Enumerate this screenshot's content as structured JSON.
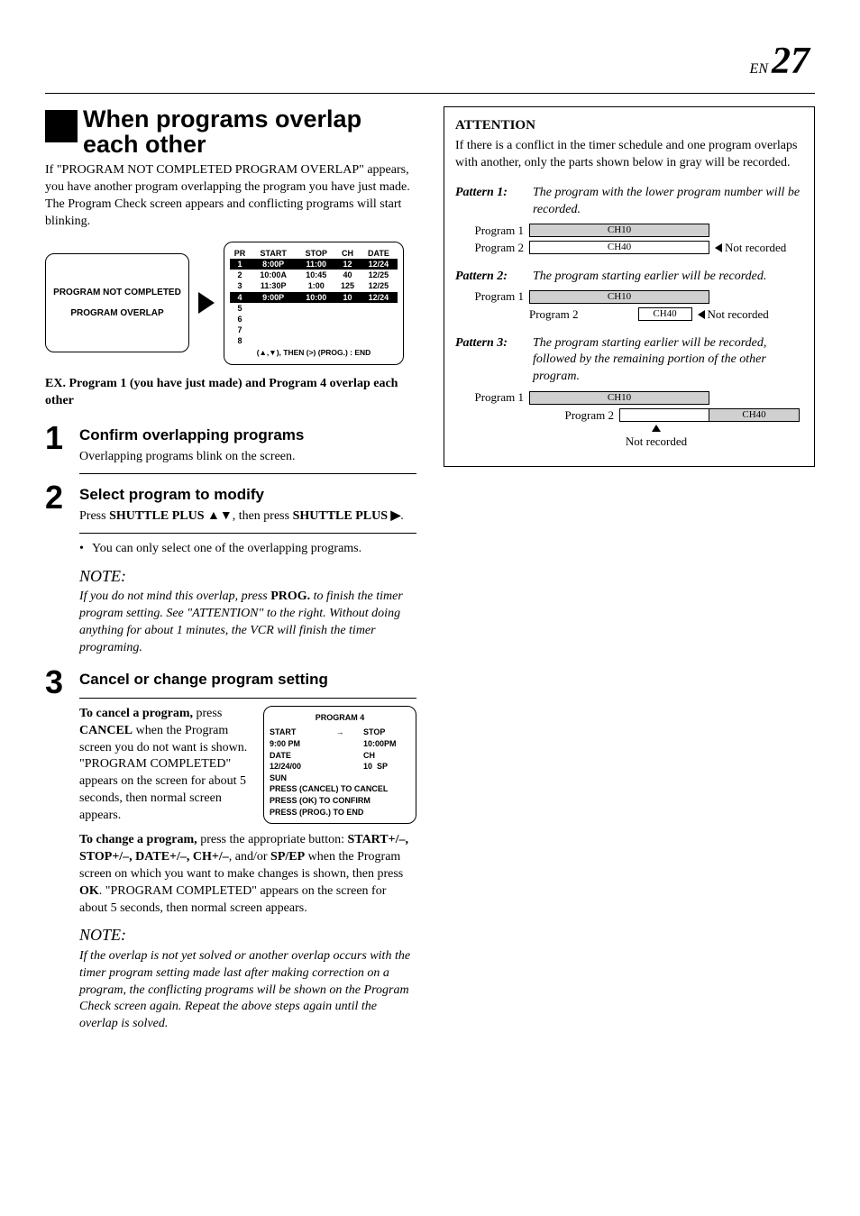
{
  "page": {
    "prefix": "EN",
    "number": "27"
  },
  "section": {
    "title": "When programs overlap each other",
    "intro": "If \"PROGRAM NOT COMPLETED PROGRAM OVERLAP\" appears, you have another program overlapping the program you have just made. The Program Check screen appears and conflicting programs will start blinking."
  },
  "figure1": {
    "left_line1": "PROGRAM NOT COMPLETED",
    "left_line2": "PROGRAM OVERLAP",
    "table": {
      "headers": [
        "PR",
        "START",
        "STOP",
        "CH",
        "DATE"
      ],
      "rows": [
        [
          "1",
          "8:00P",
          "11:00",
          "12",
          "12/24"
        ],
        [
          "2",
          "10:00A",
          "10:45",
          "40",
          "12/25"
        ],
        [
          "3",
          "11:30P",
          "1:00",
          "125",
          "12/25"
        ],
        [
          "4",
          "9:00P",
          "10:00",
          "10",
          "12/24"
        ],
        [
          "5",
          "",
          "",
          "",
          ""
        ],
        [
          "6",
          "",
          "",
          "",
          ""
        ],
        [
          "7",
          "",
          "",
          "",
          ""
        ],
        [
          "8",
          "",
          "",
          "",
          ""
        ]
      ],
      "footer": "(▲,▼), THEN (>) (PROG.) : END"
    }
  },
  "ex_line": "EX. Program 1 (you have just made) and Program 4 overlap each other",
  "steps": {
    "s1": {
      "num": "1",
      "heading": "Confirm overlapping programs",
      "body": "Overlapping programs blink on the screen."
    },
    "s2": {
      "num": "2",
      "heading": "Select program to modify",
      "body_prefix": "Press ",
      "body_bold1": "SHUTTLE PLUS ▲▼",
      "body_mid": ", then press ",
      "body_bold2": "SHUTTLE PLUS ▶",
      "body_suffix": "."
    },
    "s2_bullet": "You can only select one of the overlapping programs.",
    "note1_head": "NOTE:",
    "note1_body_a": "If you do not mind this overlap, press ",
    "note1_bold": "PROG.",
    "note1_body_b": " to finish the timer program setting. See \"ATTENTION\" to the right. Without doing anything for about 1 minutes, the VCR will finish the timer programing.",
    "s3": {
      "num": "3",
      "heading": "Cancel or change program setting",
      "cancel_label": "To cancel a program,",
      "cancel_body_a": " press ",
      "cancel_bold": "CANCEL",
      "cancel_body_b": " when the Program screen you do not want is shown. \"PROGRAM COMPLETED\" appears on the screen for about 5 seconds, then normal screen appears.",
      "change_label": "To change a program,",
      "change_body_a": " press the appropriate button: ",
      "change_bold": "START+/–, STOP+/–, DATE+/–, CH+/–",
      "change_body_b": ", and/or ",
      "change_bold2": "SP/EP",
      "change_body_c": " when the Program screen on which you want to make changes is shown, then press ",
      "change_bold3": "OK",
      "change_body_d": ". \"PROGRAM COMPLETED\" appears on the screen for about 5 seconds, then normal screen appears."
    },
    "note2_head": "NOTE:",
    "note2_body": "If the overlap is not yet solved or another overlap occurs with the timer program setting made last after making correction on a program, the conflicting programs will be shown on the Program Check screen again. Repeat the above steps again until the overlap is solved."
  },
  "prog4": {
    "title": "PROGRAM 4",
    "start_label": "START",
    "start_val": "9:00 PM",
    "stop_label": "STOP",
    "stop_val": "10:00PM",
    "date_label": "DATE",
    "date_val": "12/24/00",
    "ch_label": "CH",
    "ch_val": "10",
    "sp": "SP",
    "day": "SUN",
    "l1": "PRESS (CANCEL) TO CANCEL",
    "l2": "PRESS (OK) TO CONFIRM",
    "l3": "PRESS (PROG.) TO END"
  },
  "attention": {
    "title": "ATTENTION",
    "intro": "If there is a conflict in the timer schedule and one program overlaps with another, only the parts shown below in gray will be recorded.",
    "p1_label": "Pattern 1:",
    "p1_desc": "The program with the lower program number will be recorded.",
    "p2_label": "Pattern 2:",
    "p2_desc": "The program starting earlier will be recorded.",
    "p3_label": "Pattern 3:",
    "p3_desc": "The program starting earlier will be recorded, followed by the remaining portion of the other program.",
    "prog1": "Program 1",
    "prog2": "Program 2",
    "ch10": "CH10",
    "ch40": "CH40",
    "not_rec": "Not recorded"
  }
}
